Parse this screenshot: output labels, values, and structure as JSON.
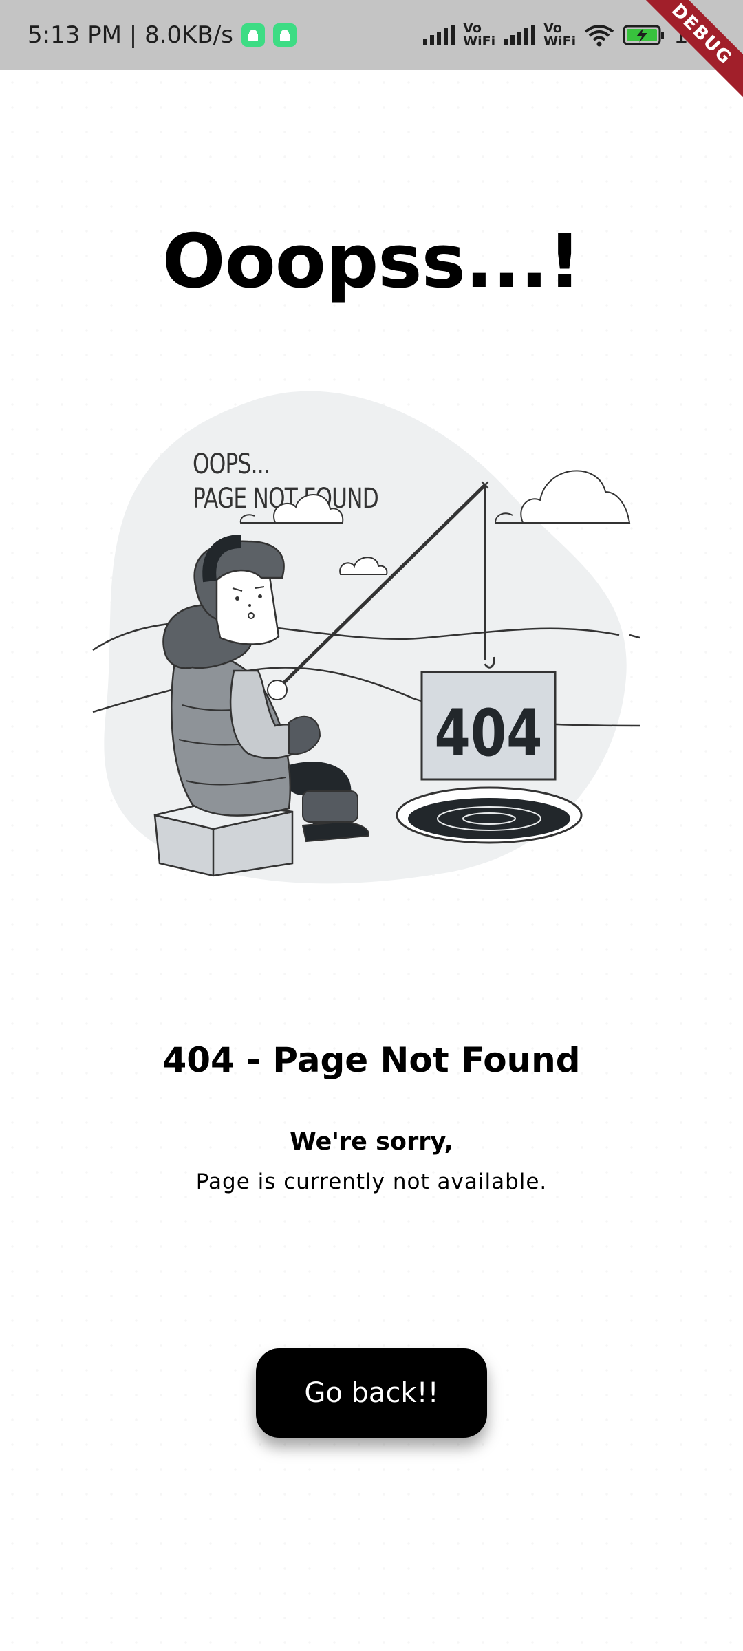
{
  "status_bar": {
    "time_speed": "5:13 PM | 8.0KB/s",
    "vowifi_top": "Vo",
    "vowifi_bottom": "WiFi",
    "battery": "100"
  },
  "debug_banner": "DEBUG",
  "title": "Ooopss...!",
  "illustration": {
    "caption_line1": "OOPS...",
    "caption_line2": "PAGE NOT FOUND",
    "sign_text": "404"
  },
  "heading": "404 - Page Not Found",
  "sorry": "We're sorry,",
  "description": "Page is currently not available.",
  "button_label": "Go back!!"
}
